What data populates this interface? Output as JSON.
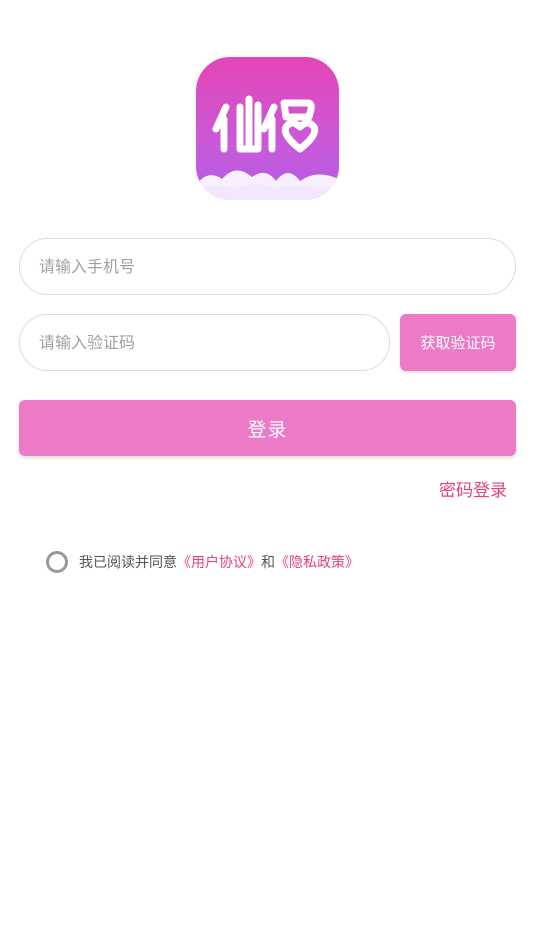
{
  "logo": {
    "icon": "app-logo-icon",
    "text": "仙侣",
    "colors": [
      "#e545b6",
      "#b35be8"
    ]
  },
  "phone": {
    "placeholder": "请输入手机号",
    "value": ""
  },
  "code": {
    "placeholder": "请输入验证码",
    "value": "",
    "button_label": "获取验证码"
  },
  "login": {
    "label": "登录",
    "color": "#ec7ac7"
  },
  "password_login": {
    "label": "密码登录",
    "color": "#e8407a"
  },
  "agreement": {
    "checked": false,
    "prefix": "我已阅读并同意",
    "user_agreement": "《用户协议》",
    "and": "和",
    "privacy_policy": "《隐私政策》"
  }
}
